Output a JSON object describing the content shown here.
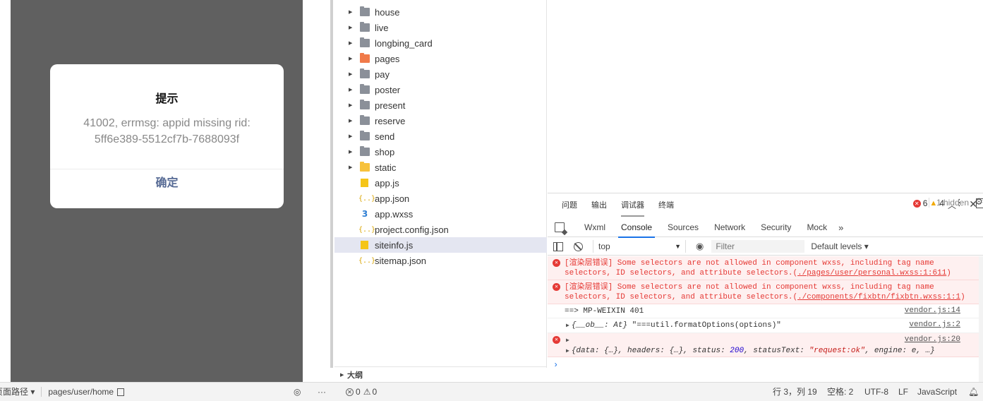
{
  "simulator": {
    "modal": {
      "title": "提示",
      "message_line1": "41002, errmsg: appid missing rid:",
      "message_line2": "5ff6e389-5512cf7b-7688093f",
      "confirm_label": "确定"
    }
  },
  "file_tree": {
    "folders": [
      {
        "name": "house",
        "icon": "folder-icon"
      },
      {
        "name": "live",
        "icon": "folder-icon"
      },
      {
        "name": "longbing_card",
        "icon": "folder-icon"
      },
      {
        "name": "pages",
        "icon": "folder-pages-icon"
      },
      {
        "name": "pay",
        "icon": "folder-icon"
      },
      {
        "name": "poster",
        "icon": "folder-icon"
      },
      {
        "name": "present",
        "icon": "folder-icon"
      },
      {
        "name": "reserve",
        "icon": "folder-icon"
      },
      {
        "name": "send",
        "icon": "folder-icon"
      },
      {
        "name": "shop",
        "icon": "folder-icon"
      },
      {
        "name": "static",
        "icon": "folder-static-icon"
      }
    ],
    "files": [
      {
        "name": "app.js",
        "icon": "js-file-icon"
      },
      {
        "name": "app.json",
        "icon": "json-file-icon"
      },
      {
        "name": "app.wxss",
        "icon": "css-file-icon"
      },
      {
        "name": "project.config.json",
        "icon": "json-file-icon"
      },
      {
        "name": "siteinfo.js",
        "icon": "js-file-icon",
        "selected": true
      },
      {
        "name": "sitemap.json",
        "icon": "json-file-icon"
      }
    ],
    "outline_label": "大纲"
  },
  "devtools": {
    "panel_tabs": [
      "问题",
      "输出",
      "调试器",
      "终端"
    ],
    "active_panel_tab": "调试器",
    "console_tabs": [
      "Wxml",
      "Console",
      "Sources",
      "Network",
      "Security",
      "Mock"
    ],
    "active_console_tab": "Console",
    "error_count": "6",
    "warning_count": "4",
    "context_select": "top",
    "filter_placeholder": "Filter",
    "levels_label": "Default levels ▾",
    "hidden_label": "1 hidden",
    "logs": {
      "e1_prefix": "[渲染层错误] Some selectors are not allowed in component wxss, including tag name",
      "e1_line2a": "selectors, ID selectors, and attribute selectors.(",
      "e1_link": "./pages/user/personal.wxss:1:611",
      "e1_line2b": ")",
      "e2_prefix": "[渲染层错误] Some selectors are not allowed in component wxss, including tag name",
      "e2_line2a": "selectors, ID selectors, and attribute selectors.(",
      "e2_link": "./components/fixbtn/fixbtn.wxss:1:1",
      "e2_line2b": ")",
      "l3_text": "==> MP-WEIXIN 401",
      "l3_src": "vendor.js:14",
      "l4_obj": "{__ob__: At}",
      "l4_str": "\"===util.formatOptions(options)\"",
      "l4_src": "vendor.js:2",
      "l5_src": "vendor.js:20",
      "l5_obj_a": "{data: {…}, headers: {…}, status: ",
      "l5_num": "200",
      "l5_obj_b": ", statusText: ",
      "l5_str": "\"request:ok\"",
      "l5_obj_c": ", engine: e, …}"
    }
  },
  "status_bar": {
    "path_label": "页面路径 ▾",
    "path_value": "pages/user/home",
    "errors": "0",
    "warnings": "0",
    "cursor": "行 3，列 19",
    "spaces": "空格: 2",
    "encoding": "UTF-8",
    "eol": "LF",
    "language": "JavaScript"
  },
  "colors": {
    "simulator_bg": "#606060",
    "modal_confirm": "#576b95",
    "error_text": "#e53935",
    "active_tab_underline": "#1a73e8"
  }
}
